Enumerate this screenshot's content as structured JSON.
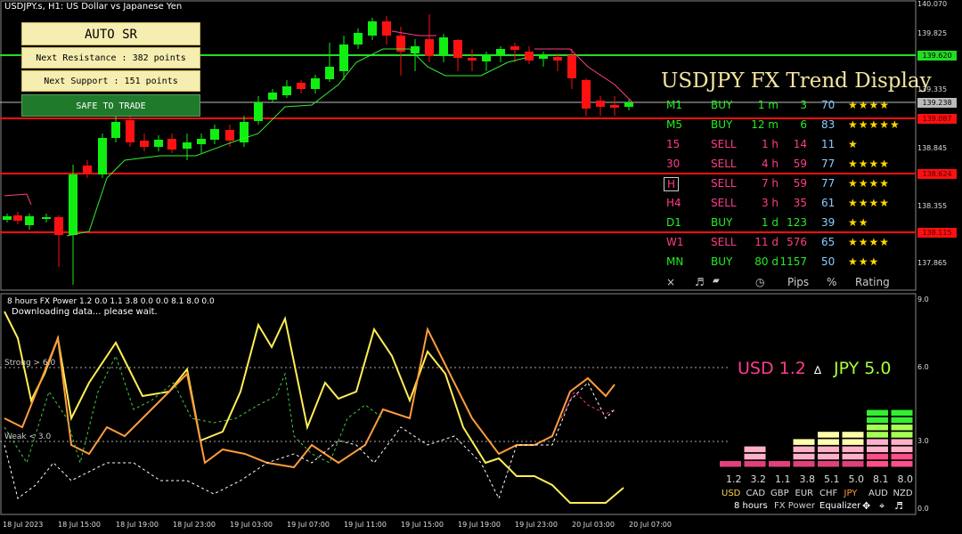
{
  "header": {
    "title": "USDJPY.s, H1:  US Dollar vs Japanese Yen"
  },
  "panel": {
    "auto_sr": "AUTO SR",
    "next_resistance": "Next Resistance : 382 points",
    "next_support": "Next Support : 151 points",
    "safe": "SAFE TO TRADE"
  },
  "trend_display": {
    "title": "USDJPY FX Trend Display",
    "rows": [
      {
        "tf": "M1",
        "dir": "BUY",
        "dur": "1 m",
        "pips": "3",
        "pct": "70",
        "stars": "★★★★"
      },
      {
        "tf": "M5",
        "dir": "BUY",
        "dur": "12 m",
        "pips": "6",
        "pct": "83",
        "stars": "★★★★★"
      },
      {
        "tf": "15",
        "dir": "SELL",
        "dur": "1 h",
        "pips": "14",
        "pct": "11",
        "stars": "★"
      },
      {
        "tf": "30",
        "dir": "SELL",
        "dur": "4 h",
        "pips": "59",
        "pct": "77",
        "stars": "★★★★"
      },
      {
        "tf": "H",
        "dir": "SELL",
        "dur": "7 h",
        "pips": "59",
        "pct": "77",
        "stars": "★★★★"
      },
      {
        "tf": "H4",
        "dir": "SELL",
        "dur": "3 h",
        "pips": "35",
        "pct": "61",
        "stars": "★★★★"
      },
      {
        "tf": "D1",
        "dir": "BUY",
        "dur": "1 d",
        "pips": "123",
        "pct": "39",
        "stars": "★★"
      },
      {
        "tf": "W1",
        "dir": "SELL",
        "dur": "11 d",
        "pips": "576",
        "pct": "65",
        "stars": "★★★★"
      },
      {
        "tf": "MN",
        "dir": "BUY",
        "dur": "80 d",
        "pips": "1157",
        "pct": "50",
        "stars": "★★★"
      }
    ],
    "footer": {
      "close": "×",
      "sound": "♬",
      "pips": "Pips",
      "pct": "%",
      "rating": "Rating"
    }
  },
  "price_axis": [
    "140.070",
    "139.825",
    "139.335",
    "138.845",
    "138.355",
    "137.865"
  ],
  "price_tags": {
    "resistance": "139.620",
    "current": "139.238",
    "red1": "139.087",
    "red2": "138.624",
    "red3": "138.115"
  },
  "indicator": {
    "title": "8 hours FX Power 1.2 0.0 1.1 3.8 0.0 0.0 8.1 8.0 0.0",
    "status": "Downloading data... please wait.",
    "strong": "Strong > 6.0",
    "weak": "Weak < 3.0",
    "usd": "USD 1.2",
    "delta": "∆",
    "jpy": "JPY 5.0",
    "axis": [
      "9.0",
      "6.0",
      "3.0",
      "0.0"
    ]
  },
  "equalizer": {
    "values": [
      "1.2",
      "3.2",
      "1.1",
      "3.8",
      "5.1",
      "5.0",
      "8.1",
      "8.0"
    ],
    "currencies": [
      "USD",
      "CAD",
      "GBP",
      "EUR",
      "CHF",
      "JPY",
      "AUD",
      "NZD"
    ],
    "footer_hours": "8 hours",
    "footer_name": "FX Power",
    "footer_eq": "Equalizer"
  },
  "dates": [
    "18 Jul 2023",
    "18 Jul 15:00",
    "18 Jul 19:00",
    "18 Jul 23:00",
    "19 Jul 03:00",
    "19 Jul 07:00",
    "19 Jul 11:00",
    "19 Jul 15:00",
    "19 Jul 19:00",
    "19 Jul 23:00",
    "20 Jul 03:00",
    "20 Jul 07:00"
  ],
  "colors": {
    "green_line": "#22dd22",
    "red_line": "#ff1010",
    "bull": "#11ee11",
    "bear": "#ff1111",
    "gold": "#f5e6a0",
    "pink": "#ff3c8c",
    "lime": "#a8ff3c",
    "orange": "#ff9c3c",
    "yellow": "#ffee55"
  }
}
